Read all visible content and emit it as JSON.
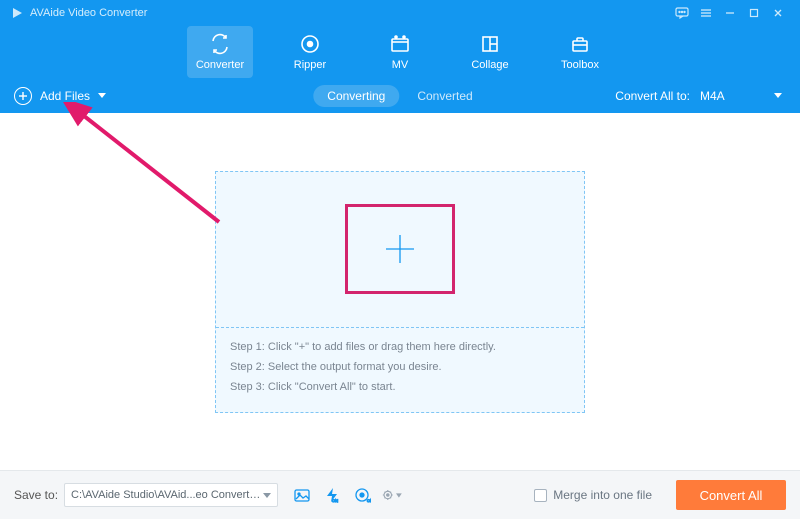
{
  "title": "AVAide Video Converter",
  "nav": {
    "converter": "Converter",
    "ripper": "Ripper",
    "mv": "MV",
    "collage": "Collage",
    "toolbox": "Toolbox"
  },
  "subbar": {
    "add_files": "Add Files",
    "converting": "Converting",
    "converted": "Converted",
    "convert_all_to": "Convert All to:",
    "format": "M4A"
  },
  "dropzone": {
    "step1": "Step 1: Click \"+\" to add files or drag them here directly.",
    "step2": "Step 2: Select the output format you desire.",
    "step3": "Step 3: Click \"Convert All\" to start."
  },
  "bottom": {
    "save_to_label": "Save to:",
    "save_path": "C:\\AVAide Studio\\AVAid...eo Converter\\Converted",
    "merge_label": "Merge into one file",
    "convert_all": "Convert All"
  }
}
